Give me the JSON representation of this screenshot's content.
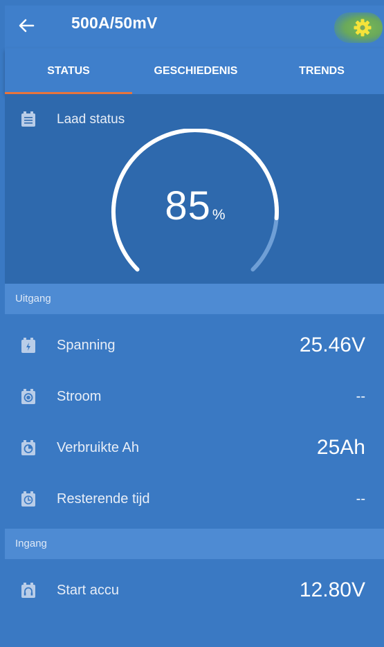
{
  "header": {
    "title": "500A/50mV",
    "back_icon": "arrow-left-icon",
    "settings_icon": "gear-icon",
    "settings_icon_color": "#f5e33a"
  },
  "tabs": [
    {
      "label": "STATUS",
      "active": true
    },
    {
      "label": "GESCHIEDENIS",
      "active": false
    },
    {
      "label": "TRENDS",
      "active": false
    }
  ],
  "accent_color": "#e8743c",
  "gauge": {
    "label": "Laad status",
    "icon": "battery-list-icon",
    "value": "85",
    "unit": "%",
    "fraction": 0.85
  },
  "sections": {
    "output": {
      "title": "Uitgang",
      "rows": [
        {
          "label": "Spanning",
          "value": "25.46V",
          "icon": "voltage-bolt-icon"
        },
        {
          "label": "Stroom",
          "value": "--",
          "icon": "current-icon"
        },
        {
          "label": "Verbruikte Ah",
          "value": "25Ah",
          "icon": "consumed-ah-icon"
        },
        {
          "label": "Resterende tijd",
          "value": "--",
          "icon": "clock-icon"
        }
      ]
    },
    "input": {
      "title": "Ingang",
      "rows": [
        {
          "label": "Start accu",
          "value": "12.80V",
          "icon": "starter-battery-icon"
        }
      ]
    }
  }
}
